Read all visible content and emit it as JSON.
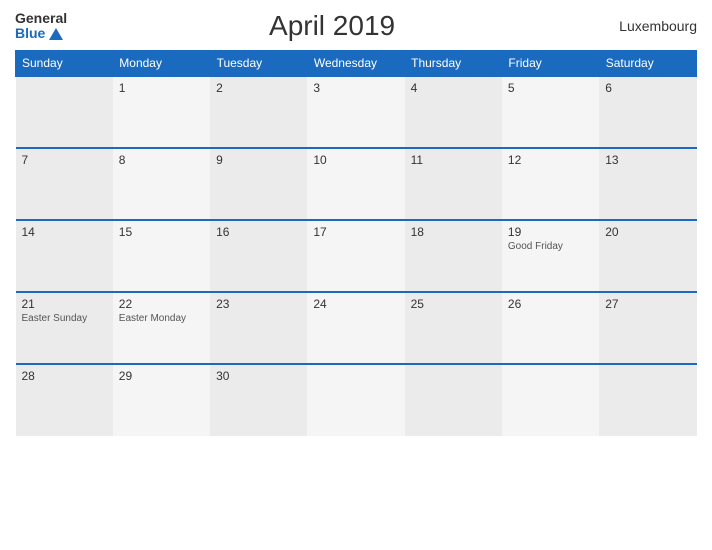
{
  "header": {
    "logo_general": "General",
    "logo_blue": "Blue",
    "title": "April 2019",
    "country": "Luxembourg"
  },
  "weekdays": [
    "Sunday",
    "Monday",
    "Tuesday",
    "Wednesday",
    "Thursday",
    "Friday",
    "Saturday"
  ],
  "weeks": [
    [
      {
        "day": ""
      },
      {
        "day": "1"
      },
      {
        "day": "2"
      },
      {
        "day": "3"
      },
      {
        "day": "4"
      },
      {
        "day": "5"
      },
      {
        "day": "6"
      }
    ],
    [
      {
        "day": "7"
      },
      {
        "day": "8"
      },
      {
        "day": "9"
      },
      {
        "day": "10"
      },
      {
        "day": "11"
      },
      {
        "day": "12"
      },
      {
        "day": "13"
      }
    ],
    [
      {
        "day": "14"
      },
      {
        "day": "15"
      },
      {
        "day": "16"
      },
      {
        "day": "17"
      },
      {
        "day": "18"
      },
      {
        "day": "19",
        "event": "Good Friday"
      },
      {
        "day": "20"
      }
    ],
    [
      {
        "day": "21",
        "event": "Easter Sunday"
      },
      {
        "day": "22",
        "event": "Easter Monday"
      },
      {
        "day": "23"
      },
      {
        "day": "24"
      },
      {
        "day": "25"
      },
      {
        "day": "26"
      },
      {
        "day": "27"
      }
    ],
    [
      {
        "day": "28"
      },
      {
        "day": "29"
      },
      {
        "day": "30"
      },
      {
        "day": ""
      },
      {
        "day": ""
      },
      {
        "day": ""
      },
      {
        "day": ""
      }
    ]
  ]
}
